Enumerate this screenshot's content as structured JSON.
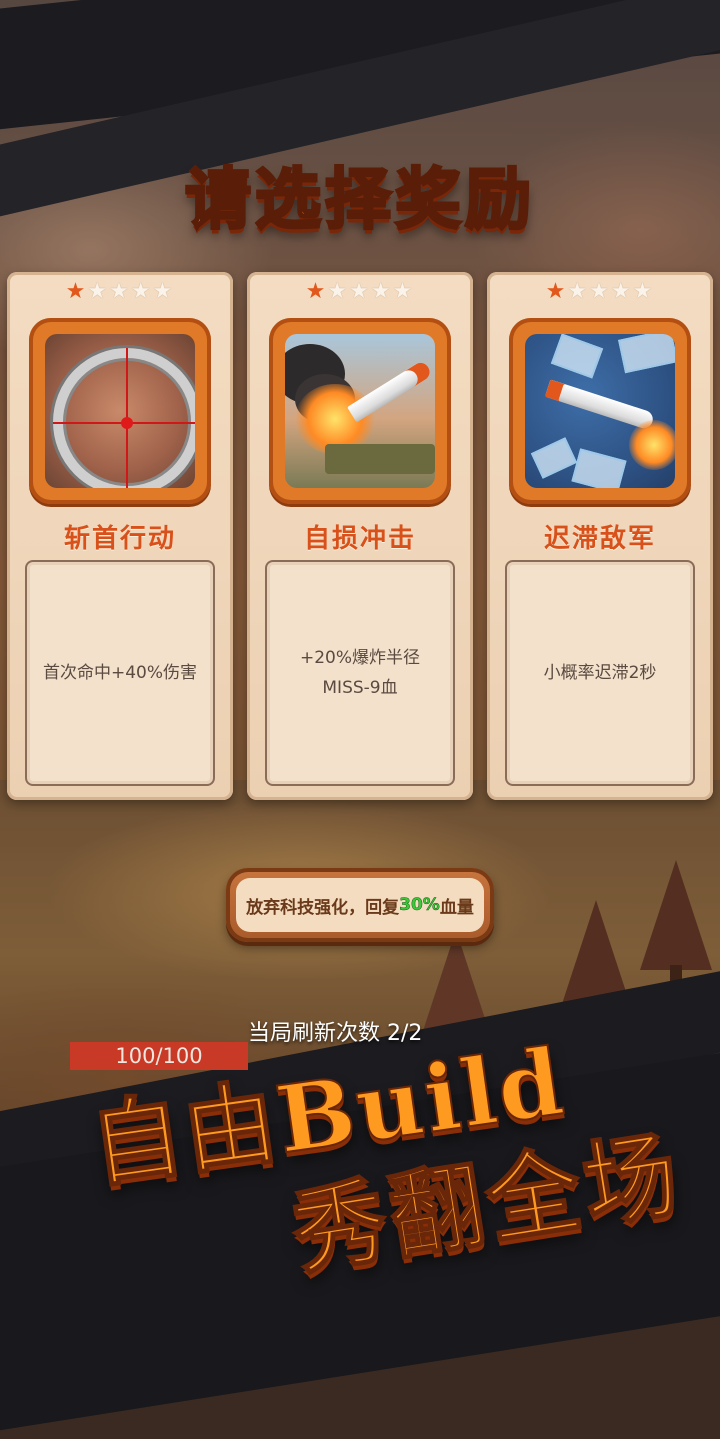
{
  "screen": {
    "title": "请选择奖励"
  },
  "cards": [
    {
      "stars_filled": 1,
      "stars_total": 5,
      "name": "斩首行动",
      "description": "首次命中+40%伤害",
      "art_icon": "sniper-scope-icon"
    },
    {
      "stars_filled": 1,
      "stars_total": 5,
      "name": "自损冲击",
      "description_line1": "+20%爆炸半径",
      "description_line2": "MISS-9血",
      "art_icon": "missile-explosion-icon"
    },
    {
      "stars_filled": 1,
      "stars_total": 5,
      "name": "迟滞敌军",
      "description": "小概率迟滞2秒",
      "art_icon": "ice-missile-icon"
    }
  ],
  "giveup_button": {
    "label_prefix": "放弃科技强化，回复",
    "label_percent": "30%",
    "label_suffix": "血量",
    "percent_color": "#3cc83a"
  },
  "refresh_text": "当局刷新次数 2/2",
  "hp": {
    "text": "100/100",
    "fraction": 1.0
  },
  "promo": {
    "line1": "自由Build",
    "line2": "秀翻全场"
  },
  "colors": {
    "title_orange": "#ff8a2a",
    "card_name": "#d8501a",
    "star_filled": "#e2571c"
  }
}
